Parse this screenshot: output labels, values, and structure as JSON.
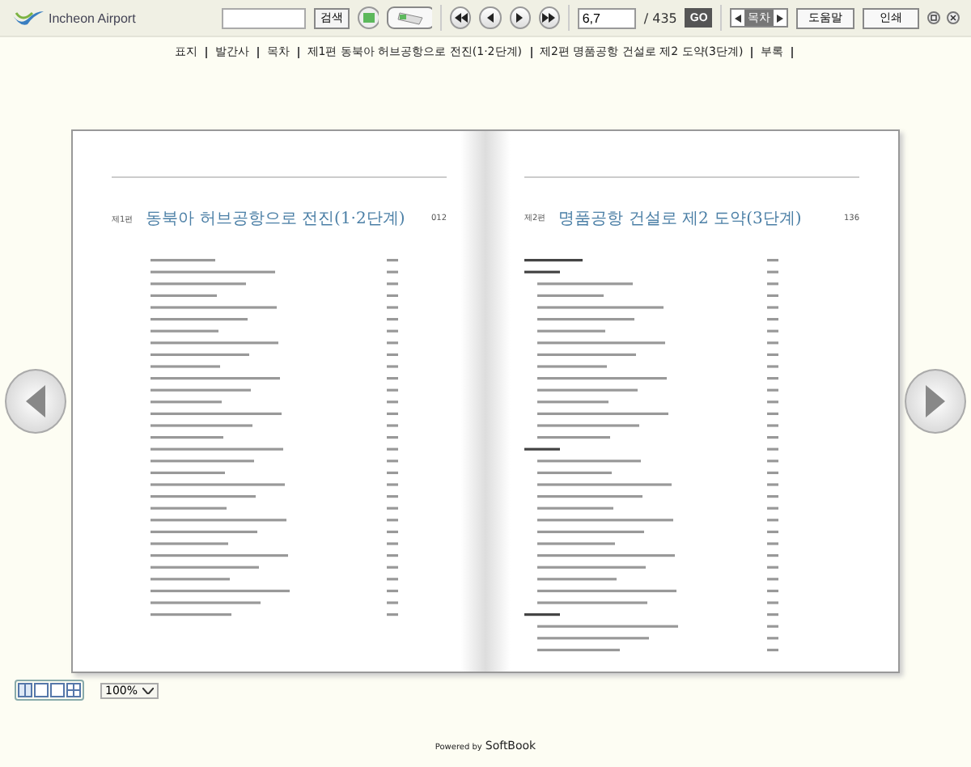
{
  "logo": {
    "text": "Incheon Airport"
  },
  "toolbar": {
    "search_button": "검색",
    "page_field": "6,7",
    "page_total": "/ 435",
    "go_button": "GO",
    "toggle_label": "목차",
    "buttons": [
      "도움말",
      "인쇄"
    ]
  },
  "nav": [
    "표지",
    "발간사",
    "목차",
    "제1편 동북아 허브공항으로 전진(1·2단계)",
    "제2편 명품공항 건설로 제2 도약(3단계)",
    "부록"
  ],
  "pages": [
    {
      "part": "제1편",
      "title": "동북아 허브공항으로 전진(1·2단계)",
      "page": "012"
    },
    {
      "part": "제2편",
      "title": "명품공항 건설로 제2 도약(3단계)",
      "page": "136"
    }
  ],
  "zoom": "100%",
  "footer": {
    "prefix": "Powered by",
    "brand": "SoftBook"
  }
}
